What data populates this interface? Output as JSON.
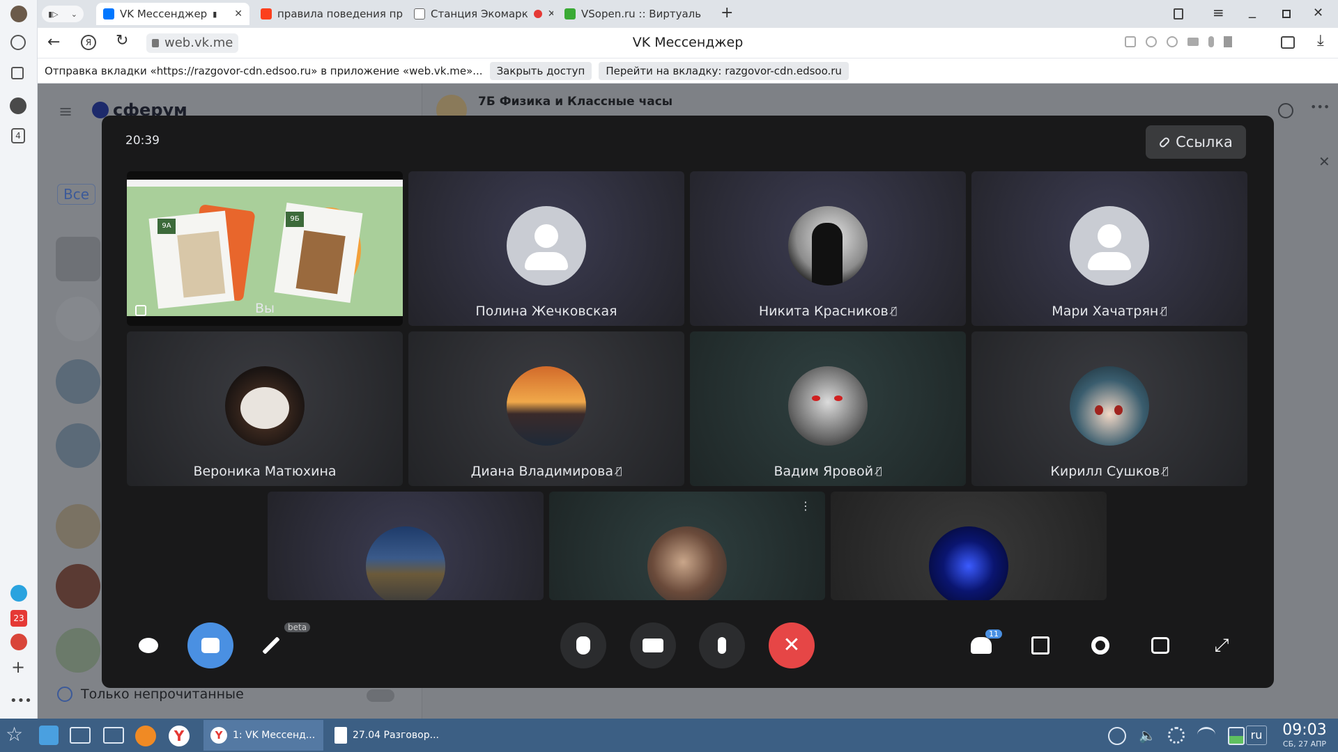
{
  "browser": {
    "tabs": [
      {
        "title": "VK Мессенджер",
        "active": true,
        "fav_color": "#0077ff"
      },
      {
        "title": "правила поведения пр",
        "active": false,
        "fav_color": "#fc3f1d"
      },
      {
        "title": "Станция Экомарк",
        "active": false,
        "fav_color": "#ffffff"
      },
      {
        "title": "VSopen.ru :: Виртуаль",
        "active": false,
        "fav_color": "#3aaa35"
      }
    ],
    "address": "web.vk.me",
    "page_title": "VK Мессенджер",
    "notification": {
      "text": "Отправка вкладки «https://razgovor-cdn.edsoo.ru» в приложение «web.vk.me»...",
      "close_btn": "Закрыть доступ",
      "go_btn": "Перейти на вкладку: razgovor-cdn.edsoo.ru"
    },
    "sidebar_badge": "4",
    "sidebar_count": "23"
  },
  "vk": {
    "logo": "сферум",
    "chat_title": "7Б Физика и Классные часы",
    "filter_all": "Все",
    "unread_only": "Только непрочитанные"
  },
  "call": {
    "time": "20:39",
    "link_label": "Ссылка",
    "self_label": "Вы",
    "screen_tags": [
      "9А",
      "9Б"
    ],
    "participants": [
      {
        "name": "Полина Жечковская",
        "muted": false
      },
      {
        "name": "Никита Красников",
        "muted": true
      },
      {
        "name": "Мари Хачатрян",
        "muted": true
      },
      {
        "name": "Вероника Матюхина",
        "muted": false
      },
      {
        "name": "Диана Владимирова",
        "muted": true
      },
      {
        "name": "Вадим Яровой",
        "muted": true
      },
      {
        "name": "Кирилл Сушков",
        "muted": true
      }
    ],
    "participants_count": "11",
    "beta_label": "beta"
  },
  "taskbar": {
    "task1": "1: VK Мессенд...",
    "task2": "27.04 Разговор...",
    "lang": "ru",
    "clock": "09:03",
    "date": "СБ, 27 АПР"
  }
}
